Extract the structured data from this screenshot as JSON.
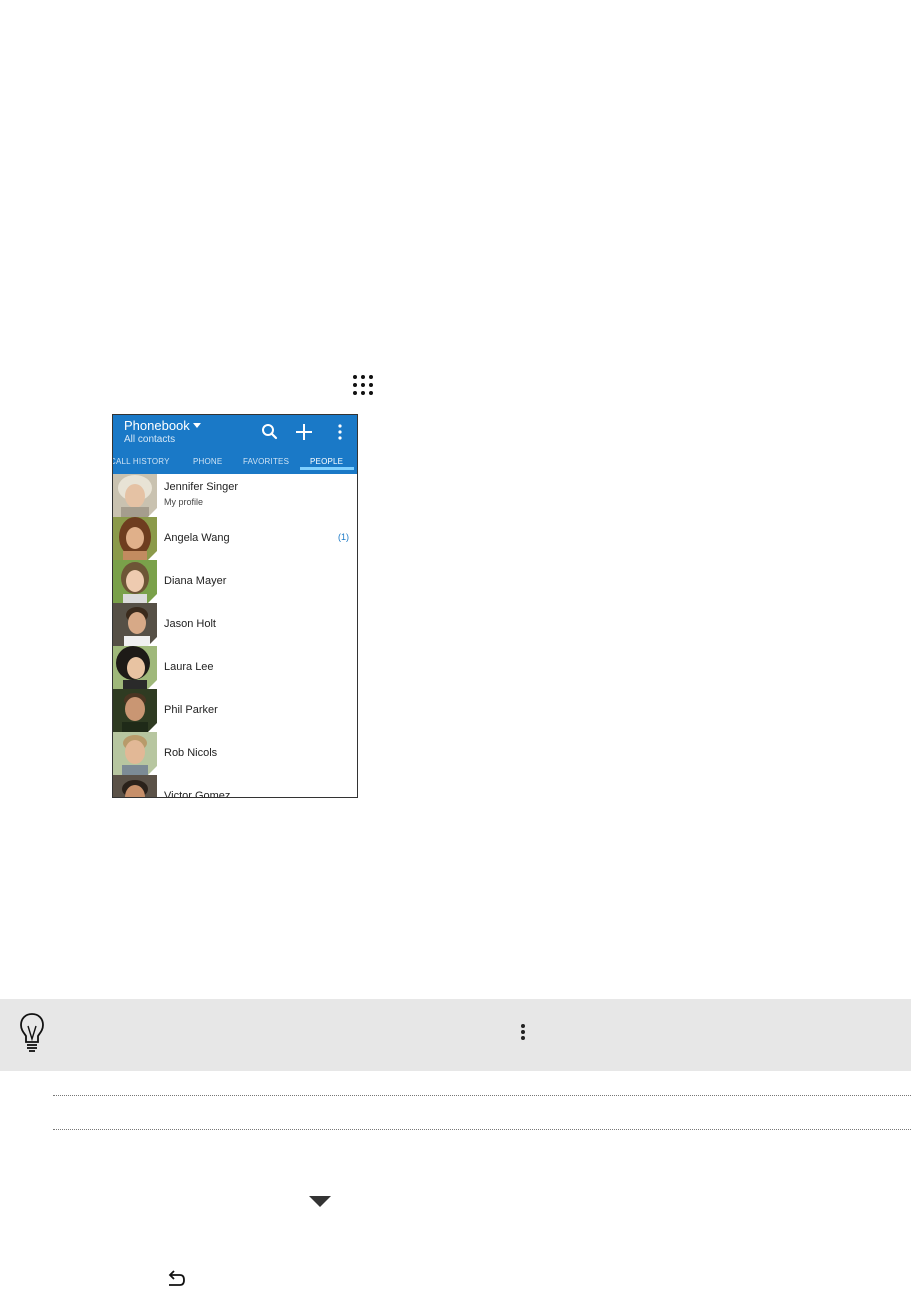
{
  "phone": {
    "appbar": {
      "title": "Phonebook",
      "subtitle": "All contacts",
      "color": "#1a79c7",
      "actions": [
        "search-icon",
        "plus-icon",
        "overflow-menu-icon"
      ]
    },
    "tabs": [
      {
        "label": "CALL HISTORY"
      },
      {
        "label": "PHONE"
      },
      {
        "label": "FAVORITES"
      },
      {
        "label": "PEOPLE",
        "active": true
      }
    ],
    "contacts": [
      {
        "name": "Jennifer Singer",
        "subtitle": "My profile"
      },
      {
        "name": "Angela Wang",
        "badge": "(1)"
      },
      {
        "name": "Diana Mayer"
      },
      {
        "name": "Jason Holt"
      },
      {
        "name": "Laura Lee"
      },
      {
        "name": "Phil Parker"
      },
      {
        "name": "Rob Nicols"
      },
      {
        "name": "Victor Gomez"
      }
    ]
  },
  "icons": [
    "apps-grid-icon",
    "lightbulb-tip-icon",
    "overflow-menu-icon",
    "dropdown-caret-icon",
    "back-icon"
  ]
}
